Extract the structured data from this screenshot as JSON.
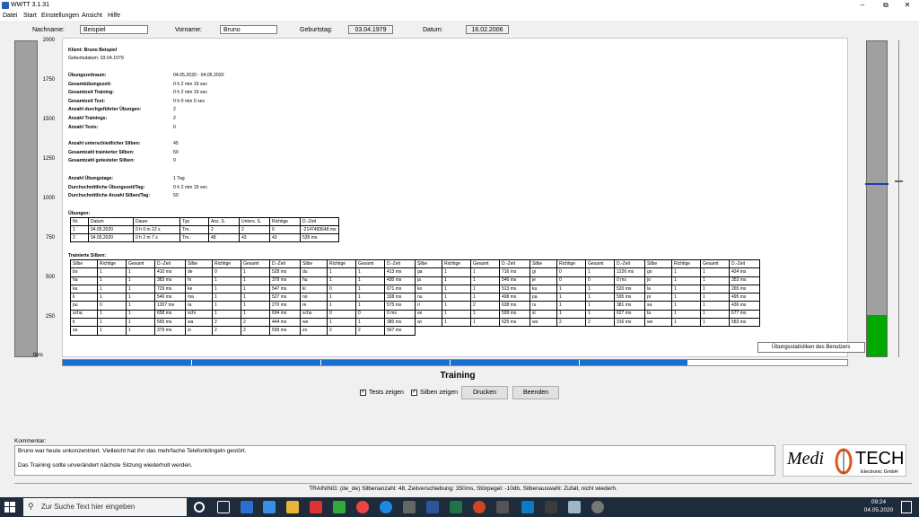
{
  "window": {
    "title": "WWTT 3.1.31"
  },
  "menu": [
    "Datei",
    "Start",
    "Einstellungen",
    "Ansicht",
    "Hilfe"
  ],
  "header": {
    "nachname_label": "Nachname:",
    "nachname": "Beispiel",
    "vorname_label": "Vorname:",
    "vorname": "Bruno",
    "geburtstag_label": "Geburtstag:",
    "geburtstag": "03.04.1979",
    "datum_label": "Datum:",
    "datum": "16.02.2006"
  },
  "y_axis": [
    "2000",
    "1750",
    "1500",
    "1250",
    "1000",
    "750",
    "500",
    "250",
    "0ms"
  ],
  "report": {
    "client": "Klient: Bruno Beispiel",
    "birth": "Geburtsdatum: 03.04.1979",
    "stats": [
      {
        "label": "Übungszeitraum:",
        "value": "04.05.2020 - 04.05.2020"
      },
      {
        "label": "Gesamtübungszeit:",
        "value": "0 h 2 min 19 sec"
      },
      {
        "label": "Gesamtzeit Training:",
        "value": "0 h 2 min 19 sec"
      },
      {
        "label": "Gesamtzeit Test:",
        "value": "0 h 0 min 0 sec"
      },
      {
        "label": "Anzahl durchgeführter Übungen:",
        "value": "2"
      },
      {
        "label": "Anzahl Trainings:",
        "value": "2"
      },
      {
        "label": "Anzahl Tests:",
        "value": "0"
      }
    ],
    "stats2": [
      {
        "label": "Anzahl unterschiedlicher Silben:",
        "value": "45"
      },
      {
        "label": "Gesamtzahl trainierter Silben:",
        "value": "50"
      },
      {
        "label": "Gesamtzahl getesteter Silben:",
        "value": "0"
      }
    ],
    "stats3": [
      {
        "label": "Anzahl Übungstage:",
        "value": "1 Tag"
      },
      {
        "label": "Durchschnittliche Übungszeit/Tag:",
        "value": "0 h 2 min 19 sec"
      },
      {
        "label": "Durchschnittliche Anzahl Silben/Tag:",
        "value": "50"
      }
    ],
    "exercises_title": "Übungen:",
    "exercise_headers": [
      "Nr.",
      "Datum",
      "Dauer",
      "Typ",
      "Anz. S.",
      "Unters. S.",
      "Richtige",
      "D.-Zeit"
    ],
    "exercises": [
      [
        "1",
        "04.05.2020",
        "0 h 0 m 12 s",
        "Trn.",
        "2",
        "2",
        "0",
        "-2147483648 ms"
      ],
      [
        "2",
        "04.05.2020",
        "0 h 2 m 7 s",
        "Trn.",
        "48",
        "43",
        "43",
        "535 ms"
      ]
    ],
    "syllables_title": "Trainierte Silben:",
    "syllable_headers": [
      "Silbe",
      "Richtige",
      "Gesamt",
      "D.-Zeit"
    ],
    "syllable_blocks": [
      [
        [
          "bo",
          "1",
          "1",
          "410 ms"
        ],
        [
          "ha",
          "1",
          "1",
          "383 ms"
        ],
        [
          "ka",
          "1",
          "1",
          "729 ms"
        ],
        [
          "li",
          "1",
          "1",
          "546 ms"
        ],
        [
          "pu",
          "0",
          "1",
          "1207 ms"
        ],
        [
          "scha",
          "1",
          "1",
          "658 ms"
        ],
        [
          "ti",
          "1",
          "1",
          "565 ms"
        ],
        [
          "za",
          "1",
          "1",
          "379 ms"
        ]
      ],
      [
        [
          "de",
          "0",
          "1",
          "-"
        ],
        [
          "hi",
          "1",
          "1",
          "-"
        ],
        [
          "ke",
          "1",
          "1",
          "-"
        ],
        [
          "ma",
          "1",
          "1",
          "-"
        ],
        [
          "ra",
          "1",
          "1",
          "-"
        ],
        [
          "schi",
          "1",
          "1",
          "-"
        ],
        [
          "wa",
          "2",
          "2",
          "-"
        ],
        [
          "zi",
          "2",
          "2",
          "-"
        ]
      ],
      [
        [
          "du",
          "1",
          "1",
          "413 ms"
        ],
        [
          "hu",
          "1",
          "1",
          "430 ms"
        ],
        [
          "ki",
          "0",
          "1",
          "671 ms"
        ],
        [
          "no",
          "1",
          "1",
          "338 ms"
        ],
        [
          "re",
          "1",
          "1",
          "575 ms"
        ],
        [
          "schu",
          "0",
          "0",
          "0 ms"
        ],
        [
          "we",
          "1",
          "1",
          "380 ms"
        ],
        [
          "zo",
          "2",
          "2",
          "567 ms"
        ]
      ],
      [
        [
          "ga",
          "1",
          "1",
          "716 ms"
        ],
        [
          "ja",
          "1",
          "1",
          "546 ms"
        ],
        [
          "ko",
          "1",
          "1",
          "513 ms"
        ],
        [
          "nu",
          "1",
          "1",
          "408 ms"
        ],
        [
          "ri",
          "1",
          "2",
          "638 ms"
        ],
        [
          "se",
          "1",
          "1",
          "599 ms"
        ],
        [
          "wi",
          "1",
          "1",
          "625 ms"
        ]
      ],
      [
        [
          "gi",
          "0",
          "1",
          "1226 ms"
        ],
        [
          "je",
          "0",
          "0",
          "0 ms"
        ],
        [
          "ku",
          "1",
          "1",
          "520 ms"
        ],
        [
          "pa",
          "1",
          "1",
          "595 ms"
        ],
        [
          "ru",
          "1",
          "1",
          "381 ms"
        ],
        [
          "si",
          "1",
          "1",
          "627 ms"
        ],
        [
          "wo",
          "2",
          "2",
          "316 ms"
        ]
      ],
      [
        [
          "go",
          "1",
          "1",
          "424 ms"
        ],
        [
          "jo",
          "1",
          "1",
          "353 ms"
        ],
        [
          "la",
          "1",
          "1",
          "265 ms"
        ],
        [
          "pi",
          "1",
          "1",
          "495 ms"
        ],
        [
          "sa",
          "1",
          "1",
          "436 ms"
        ],
        [
          "ta",
          "1",
          "1",
          "677 ms"
        ],
        [
          "we",
          "1",
          "1",
          "583 ms"
        ]
      ]
    ],
    "syllable_block_times": [
      [
        "410 ms",
        "383 ms",
        "729 ms",
        "546 ms",
        "1207 ms",
        "658 ms",
        "565 ms",
        "379 ms"
      ],
      [
        "528 ms",
        "379 ms",
        "547 ms",
        "527 ms",
        "270 ms",
        "694 ms",
        "444 ms",
        "599 ms"
      ]
    ]
  },
  "tooltip": "Übungsstatistiken des Benutzers",
  "mode_label": "Training",
  "progress_fraction": 0.795,
  "controls": {
    "tests_show": "Tests zeigen",
    "tests_checked": true,
    "syllables_show": "Silben zeigen",
    "syllables_checked": true,
    "print": "Drucken",
    "quit": "Beenden"
  },
  "comment": {
    "label": "Kommentar:",
    "line1": "Bruno war heute unkonzentriert. Vielleicht hat ihn das mehrfache Telefonklingeln gestört.",
    "line2": "Das Training sollte unverändert nächste Sitzung wiederholt werden."
  },
  "logo": {
    "text1": "Medi",
    "text2": "TECH",
    "text3": "Electronic GmbH"
  },
  "status": "TRAINING: (de_de)  Silbenanzahl: 48,  Zeitverschiebung: 350ms,  Störpegel: -10db,  Silbenauswahl: Zufall, nicht wiederh.",
  "taskbar": {
    "search_placeholder": "Zur Suche Text hier eingeben",
    "time": "09:24",
    "date": "04.05.2020"
  },
  "right_gauge": {
    "green_fraction": 0.13,
    "marker_fraction": 0.55
  },
  "colors": {
    "accent": "#1a6fcf",
    "gauge_green": "#00a800"
  }
}
